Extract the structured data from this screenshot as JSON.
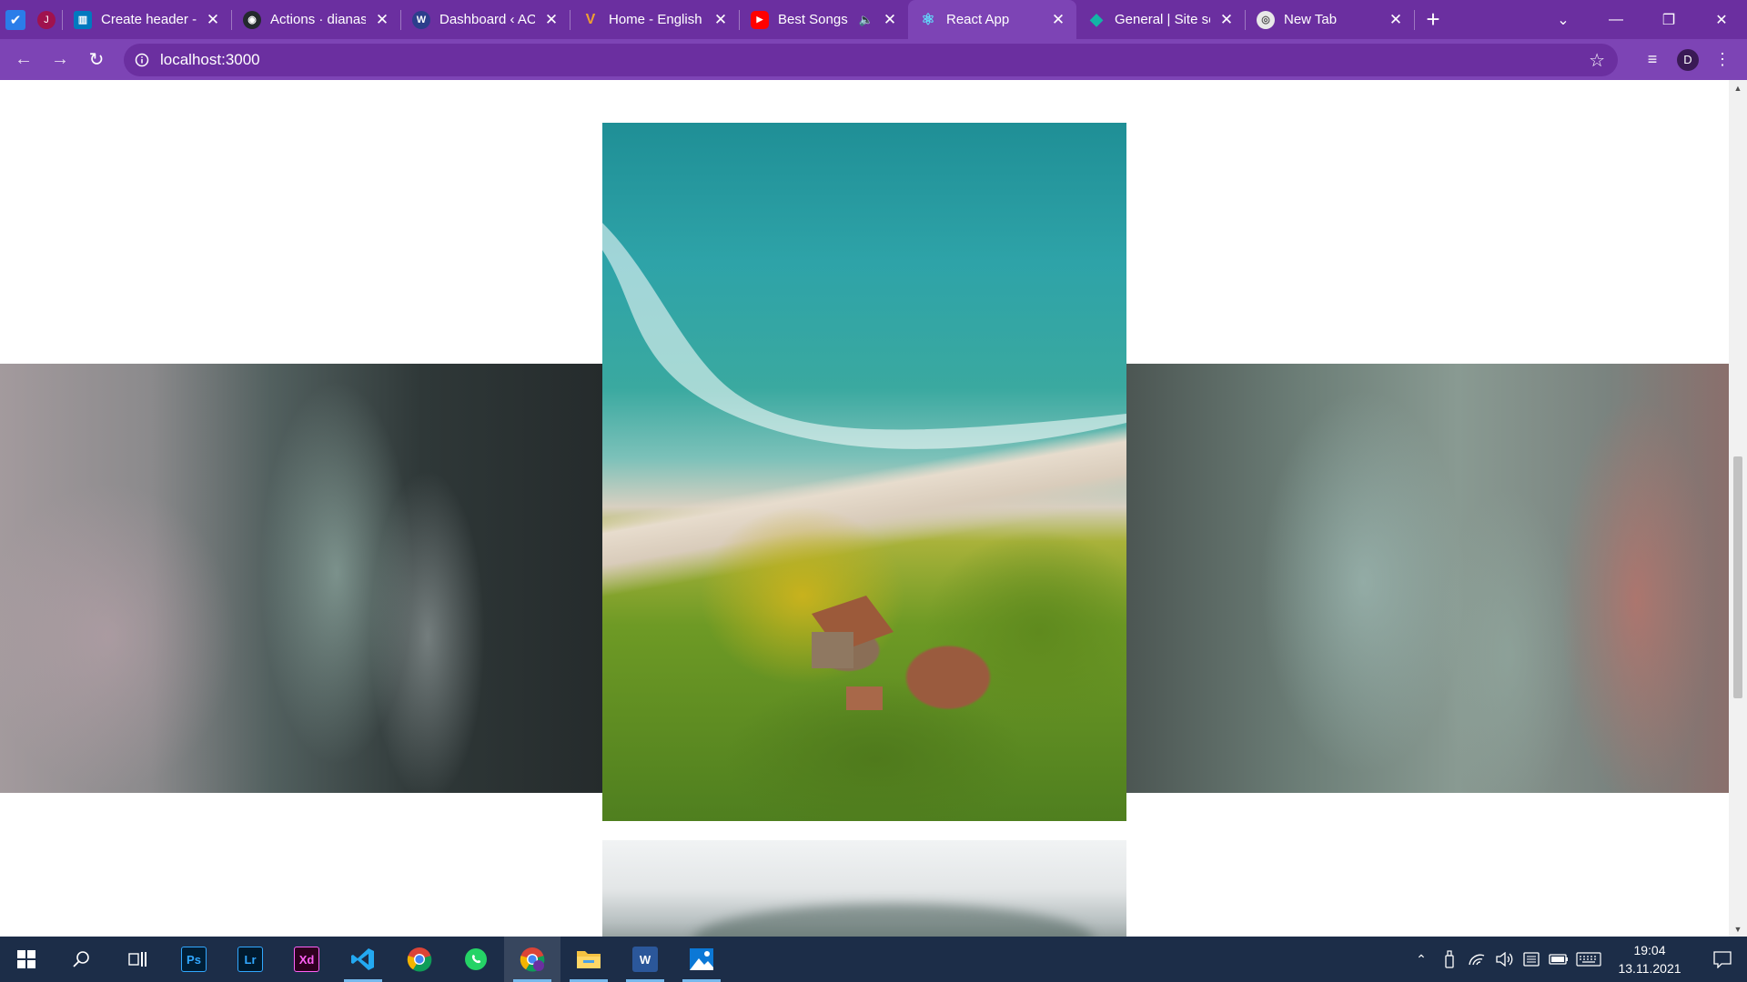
{
  "browser": {
    "tabs": [
      {
        "title": "Create header -",
        "favicon_color": "#0079bf",
        "favicon_glyph": "trello-icon",
        "audio": false,
        "active": false
      },
      {
        "title": "Actions · dianas",
        "favicon_color": "#24292e",
        "favicon_glyph": "github-icon",
        "audio": false,
        "active": false
      },
      {
        "title": "Dashboard ‹ AC",
        "favicon_color": "#2c3e8c",
        "favicon_glyph": "wordpress-icon",
        "audio": false,
        "active": false
      },
      {
        "title": "Home - English",
        "favicon_color": "#f0a030",
        "favicon_glyph": "v-logo-icon",
        "audio": false,
        "active": false
      },
      {
        "title": "Best Songs",
        "favicon_color": "#ff0000",
        "favicon_glyph": "youtube-icon",
        "audio": true,
        "active": false
      },
      {
        "title": "React App",
        "favicon_color": "#61dafb",
        "favicon_glyph": "react-icon",
        "audio": false,
        "active": true
      },
      {
        "title": "General | Site se",
        "favicon_color": "#13b5a6",
        "favicon_glyph": "diamond-icon",
        "audio": false,
        "active": false
      },
      {
        "title": "New Tab",
        "favicon_color": "#e8e8e8",
        "favicon_glyph": "chrome-icon",
        "audio": false,
        "active": false
      }
    ],
    "url": "localhost:3000",
    "profile_initial": "D",
    "accent": "#7d44b5",
    "tabbar_color": "#6b2fa0"
  },
  "page": {
    "images": [
      {
        "name": "smoke-photo-left",
        "description": "gray-green smoke"
      },
      {
        "name": "beach-aerial-photo",
        "description": "aerial beach with palms"
      },
      {
        "name": "smoke-photo-right",
        "description": "teal-red smoke"
      },
      {
        "name": "foggy-mountain-photo",
        "description": "fog over hills"
      }
    ]
  },
  "taskbar": {
    "apps": [
      {
        "name": "photoshop",
        "label": "Ps",
        "color": "#31a8ff",
        "bg": "#001e36"
      },
      {
        "name": "lightroom",
        "label": "Lr",
        "color": "#31a8ff",
        "bg": "#001a2e"
      },
      {
        "name": "adobe-xd",
        "label": "Xd",
        "color": "#ff61f6",
        "bg": "#2e001f"
      }
    ],
    "time": "19:04",
    "date": "13.11.2021"
  }
}
